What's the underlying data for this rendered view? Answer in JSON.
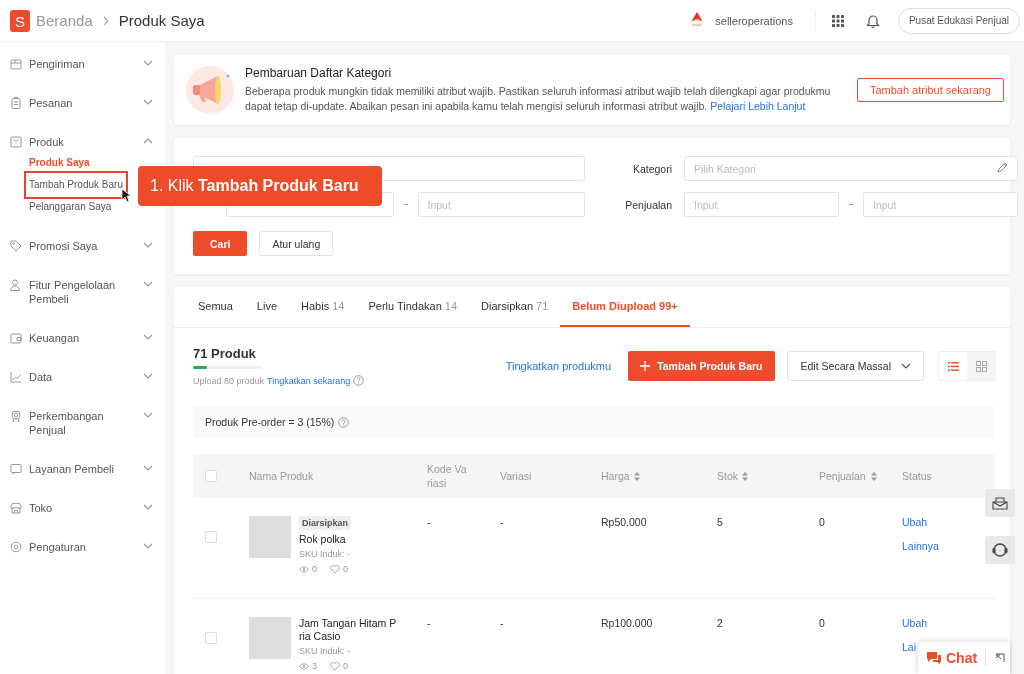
{
  "header": {
    "logo_letter": "S",
    "breadcrumb": [
      {
        "label": "Beranda"
      },
      {
        "label": "Produk Saya"
      }
    ],
    "username": "selleroperations",
    "education_button": "Pusat Edukasi Penjual"
  },
  "sidebar": {
    "items": [
      {
        "kind": "shipping",
        "label": "Pengiriman",
        "expanded": false
      },
      {
        "kind": "orders",
        "label": "Pesanan",
        "expanded": false
      },
      {
        "kind": "products",
        "label": "Produk",
        "expanded": true,
        "children": [
          {
            "label": "Produk Saya",
            "selected": true,
            "highlighted": false
          },
          {
            "label": "Tambah Produk Baru",
            "selected": false,
            "highlighted": true
          },
          {
            "label": "Pelanggaran Saya",
            "selected": false,
            "highlighted": false
          }
        ]
      },
      {
        "kind": "promo",
        "label": "Promosi Saya",
        "expanded": false
      },
      {
        "kind": "buyers",
        "label": "Fitur Pengelolaan Pembeli",
        "expanded": false
      },
      {
        "kind": "finance",
        "label": "Keuangan",
        "expanded": false
      },
      {
        "kind": "data",
        "label": "Data",
        "expanded": false
      },
      {
        "kind": "growth",
        "label": "Perkembangan Penjual",
        "expanded": false
      },
      {
        "kind": "service",
        "label": "Layanan Pembeli",
        "expanded": false
      },
      {
        "kind": "shop",
        "label": "Toko",
        "expanded": false
      },
      {
        "kind": "settings",
        "label": "Pengaturan",
        "expanded": false
      }
    ]
  },
  "callout": {
    "text": "1. Klik **Tambah Produk Baru**"
  },
  "banner": {
    "title": "Pembaruan Daftar Kategori",
    "text": "Beberapa produk mungkin tidak memiliki atribut wajib. Pastikan seluruh informasi atribut wajib telah dilengkapi agar produkmu dapat tetap di-update. Abaikan pesan ini apabila kamu telah mengisi seluruh informasi atribut wajib.",
    "link": "Pelajari Lebih Lanjut",
    "button": "Tambah atribut sekarang"
  },
  "filter": {
    "stock_max_placeholder": "Input",
    "category_label": "Kategori",
    "category_placeholder": "Pilih Kategori",
    "sales_label": "Penjualan",
    "sales_min_placeholder": "Input",
    "sales_max_placeholder": "Input",
    "search_button": "Cari",
    "reset_button": "Atur ulang"
  },
  "tabs": [
    {
      "label": "Semua",
      "selected": false
    },
    {
      "label": "Live",
      "selected": false
    },
    {
      "label": "Habis",
      "count": "14",
      "selected": false
    },
    {
      "label": "Perlu Tindakan",
      "count": "14",
      "selected": false
    },
    {
      "label": "Diarsipkan",
      "count": "71",
      "selected": false
    },
    {
      "label": "Belum Diupload",
      "count": "99+",
      "selected": true
    }
  ],
  "summary": {
    "title": "71 Produk",
    "level": 0.2,
    "upload_text": "Upload 80 produk",
    "upgrade_link": "Tingkatkan sekarang",
    "improve_link": "Tingkatkan produkmu",
    "add_button": "Tambah Produk Baru",
    "bulk_button": "Edit Secara Massal",
    "view_modes": [
      {
        "kind": "list",
        "selected": true
      },
      {
        "kind": "grid",
        "selected": false
      }
    ]
  },
  "preorder": {
    "text": "Produk Pre-order = 3 (15%)"
  },
  "table": {
    "all_checked": false,
    "columns": [
      {
        "label": "Nama Produk",
        "sortable": false
      },
      {
        "label": "Kode Variasi",
        "sortable": false
      },
      {
        "label": "Variasi",
        "sortable": false
      },
      {
        "label": "Harga",
        "sortable": true
      },
      {
        "label": "Stok",
        "sortable": true
      },
      {
        "label": "Penjualan",
        "sortable": true
      },
      {
        "label": "Status",
        "sortable": false
      }
    ],
    "rows": [
      {
        "checked": false,
        "badge": "Diarsipkan",
        "name": "Rok polka",
        "sku": "SKU Induk: -",
        "views": "0",
        "likes": "0",
        "variant_code": "-",
        "variation": "-",
        "price": "Rp50.000",
        "stock": "5",
        "sales": "0",
        "actions": [
          "Ubah",
          "Lainnya"
        ]
      },
      {
        "checked": false,
        "name": "Jam Tangan Hitam Pria Casio",
        "sku": "SKU Induk: -",
        "views": "3",
        "likes": "0",
        "variant_code": "-",
        "variation": "-",
        "price": "Rp100.000",
        "stock": "2",
        "sales": "0",
        "actions": [
          "Ubah",
          "Lai"
        ]
      }
    ]
  },
  "chat": {
    "label": "Chat"
  }
}
